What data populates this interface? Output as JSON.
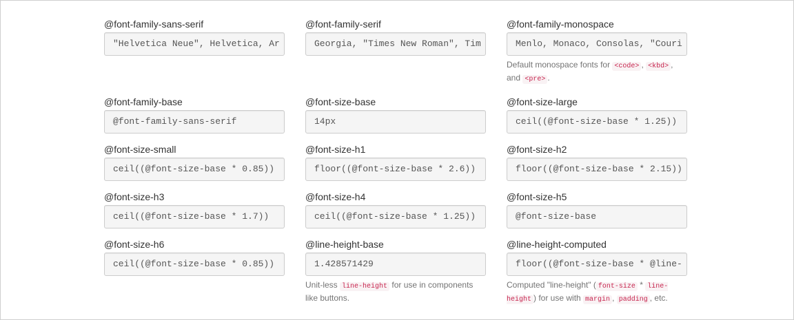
{
  "fields": {
    "sans": {
      "label": "@font-family-sans-serif",
      "value": "\"Helvetica Neue\", Helvetica, Ar"
    },
    "serif": {
      "label": "@font-family-serif",
      "value": "Georgia, \"Times New Roman\", Tim"
    },
    "mono": {
      "label": "@font-family-monospace",
      "value": "Menlo, Monaco, Consolas, \"Couri"
    },
    "base": {
      "label": "@font-family-base",
      "value": "@font-family-sans-serif"
    },
    "size_base": {
      "label": "@font-size-base",
      "value": "14px"
    },
    "size_large": {
      "label": "@font-size-large",
      "value": "ceil((@font-size-base * 1.25))"
    },
    "size_small": {
      "label": "@font-size-small",
      "value": "ceil((@font-size-base * 0.85))"
    },
    "size_h1": {
      "label": "@font-size-h1",
      "value": "floor((@font-size-base * 2.6))"
    },
    "size_h2": {
      "label": "@font-size-h2",
      "value": "floor((@font-size-base * 2.15))"
    },
    "size_h3": {
      "label": "@font-size-h3",
      "value": "ceil((@font-size-base * 1.7))"
    },
    "size_h4": {
      "label": "@font-size-h4",
      "value": "ceil((@font-size-base * 1.25))"
    },
    "size_h5": {
      "label": "@font-size-h5",
      "value": "@font-size-base"
    },
    "size_h6": {
      "label": "@font-size-h6",
      "value": "ceil((@font-size-base * 0.85))"
    },
    "line_height_base": {
      "label": "@line-height-base",
      "value": "1.428571429"
    },
    "line_height_computed": {
      "label": "@line-height-computed",
      "value": "floor((@font-size-base * @line-"
    }
  },
  "help": {
    "mono": {
      "t1": "Default monospace fonts for ",
      "c1": "<code>",
      "t2": ", ",
      "c2": "<kbd>",
      "t3": ", and ",
      "c3": "<pre>",
      "t4": "."
    },
    "line_height_base": {
      "t1": "Unit-less ",
      "c1": "line-height",
      "t2": " for use in components like buttons."
    },
    "line_height_computed": {
      "t1": "Computed \"line-height\" (",
      "c1": "font-size",
      "t2": " * ",
      "c2": "line-height",
      "t3": ") for use with ",
      "c3": "margin",
      "t4": ", ",
      "c4": "padding",
      "t5": ", etc."
    }
  }
}
